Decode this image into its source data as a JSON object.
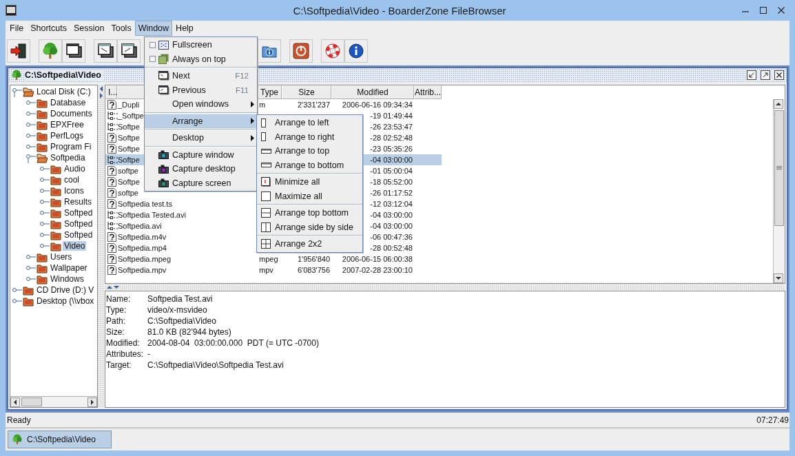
{
  "window": {
    "title": "C:\\Softpedia\\Video - BoarderZone FileBrowser"
  },
  "menu_bar": [
    {
      "label": "File",
      "selected": false
    },
    {
      "label": "Shortcuts",
      "selected": false
    },
    {
      "label": "Session",
      "selected": false
    },
    {
      "label": "Tools",
      "selected": false
    },
    {
      "label": "Window",
      "selected": true
    },
    {
      "label": "Help",
      "selected": false
    }
  ],
  "window_menu": [
    {
      "kind": "check",
      "label": "Fullscreen",
      "checked": false,
      "selected": false
    },
    {
      "kind": "check",
      "label": "Always on top",
      "checked": false,
      "selected": false
    },
    {
      "kind": "separator"
    },
    {
      "kind": "item",
      "label": "Next",
      "shortcut": "F12",
      "selected": false
    },
    {
      "kind": "item",
      "label": "Previous",
      "shortcut": "F11",
      "selected": false
    },
    {
      "kind": "submenu",
      "label": "Open windows",
      "selected": false
    },
    {
      "kind": "separator"
    },
    {
      "kind": "submenu",
      "label": "Arrange",
      "selected": true
    },
    {
      "kind": "separator"
    },
    {
      "kind": "submenu",
      "label": "Desktop",
      "selected": false
    },
    {
      "kind": "separator"
    },
    {
      "kind": "item",
      "label": "Capture window",
      "selected": false
    },
    {
      "kind": "item",
      "label": "Capture desktop",
      "selected": false
    },
    {
      "kind": "item",
      "label": "Capture screen",
      "selected": false
    }
  ],
  "arrange_menu": [
    {
      "kind": "item",
      "label": "Arrange to left",
      "selected": false
    },
    {
      "kind": "item",
      "label": "Arrange to right",
      "selected": false
    },
    {
      "kind": "item",
      "label": "Arrange to top",
      "selected": false
    },
    {
      "kind": "item",
      "label": "Arrange to bottom",
      "selected": false
    },
    {
      "kind": "separator"
    },
    {
      "kind": "item",
      "label": "Minimize all",
      "selected": false
    },
    {
      "kind": "item",
      "label": "Maximize all",
      "selected": false
    },
    {
      "kind": "separator"
    },
    {
      "kind": "item",
      "label": "Arrange top bottom",
      "selected": false
    },
    {
      "kind": "item",
      "label": "Arrange side by side",
      "selected": false
    },
    {
      "kind": "separator"
    },
    {
      "kind": "item",
      "label": "Arrange 2x2",
      "selected": false
    }
  ],
  "frame": {
    "title": "C:\\Softpedia\\Video"
  },
  "tree": [
    {
      "label": "Local Disk (C:)",
      "expanded": true,
      "selected": false,
      "children": [
        {
          "label": "Database",
          "expanded": false,
          "selected": false
        },
        {
          "label": "Documents",
          "expanded": false,
          "selected": false
        },
        {
          "label": "EPXFree",
          "expanded": false,
          "selected": false
        },
        {
          "label": "PerfLogs",
          "expanded": false,
          "selected": false
        },
        {
          "label": "Program Fi",
          "expanded": false,
          "selected": false
        },
        {
          "label": "Softpedia",
          "expanded": true,
          "selected": false,
          "children": [
            {
              "label": "Audio",
              "expanded": false,
              "selected": false
            },
            {
              "label": "cool",
              "expanded": false,
              "selected": false
            },
            {
              "label": "Icons",
              "expanded": false,
              "selected": false
            },
            {
              "label": "Results",
              "expanded": false,
              "selected": false
            },
            {
              "label": "Softped",
              "expanded": false,
              "selected": false
            },
            {
              "label": "Softped",
              "expanded": false,
              "selected": false
            },
            {
              "label": "Softped",
              "expanded": false,
              "selected": false
            },
            {
              "label": "Video",
              "expanded": false,
              "selected": true
            }
          ]
        },
        {
          "label": "Users",
          "expanded": false,
          "selected": false
        },
        {
          "label": "Wallpaper",
          "expanded": false,
          "selected": false
        },
        {
          "label": "Windows",
          "expanded": false,
          "selected": false
        }
      ]
    },
    {
      "label": "CD Drive (D:) V",
      "expanded": false,
      "selected": false
    },
    {
      "label": "Desktop (\\\\vbox",
      "expanded": false,
      "selected": false
    }
  ],
  "table": {
    "columns": [
      "I...",
      "Type",
      "Size",
      "Modified",
      "Attrib..."
    ],
    "rows": [
      {
        "kind": "unknown",
        "name": "_Dupli",
        "type": "m",
        "size": "2'331'237",
        "modified": "2006-06-16 09:34:34",
        "selected": false
      },
      {
        "kind": "linked",
        "name": "_Softpe",
        "modified": "-19 01:49:44",
        "selected": false
      },
      {
        "kind": "linked",
        "name": "Softpe",
        "modified": "-26 23:53:47",
        "selected": false
      },
      {
        "kind": "unknown",
        "name": "Softpe",
        "modified": "-28 02:52:48",
        "selected": false
      },
      {
        "kind": "unknown",
        "name": "Softpe",
        "modified": "-23 05:35:26",
        "selected": false
      },
      {
        "kind": "linked",
        "name": "Softpe",
        "modified": "-04 03:00:00",
        "selected": true
      },
      {
        "kind": "unknown",
        "name": "softpe",
        "modified": "-01 05:00:04",
        "selected": false
      },
      {
        "kind": "unknown",
        "name": "Softpe",
        "modified": "-18 05:52:00",
        "selected": false
      },
      {
        "kind": "unknown",
        "name": "softpe",
        "modified": "-26 01:17:52",
        "selected": false
      },
      {
        "kind": "unknown",
        "name": "Softpedia test.ts",
        "modified": "-12 03:12:04",
        "selected": false
      },
      {
        "kind": "linked",
        "name": "Softpedia Tested.avi",
        "modified": "-04 03:00:00",
        "selected": false
      },
      {
        "kind": "linked",
        "name": "Softpedia.avi",
        "modified": "-04 03:00:00",
        "selected": false
      },
      {
        "kind": "unknown",
        "name": "Softpedia.m4v",
        "modified": "-06 00:47:36",
        "selected": false
      },
      {
        "kind": "unknown",
        "name": "Softpedia.mp4",
        "modified": "-28 00:52:48",
        "selected": false
      },
      {
        "kind": "unknown",
        "name": "Softpedia.mpeg",
        "type": "mpeg",
        "size": "1'956'840",
        "modified": "2006-06-15 06:00:38",
        "selected": false
      },
      {
        "kind": "unknown",
        "name": "Softpedia.mpv",
        "type": "mpv",
        "size": "6'083'756",
        "modified": "2007-02-28 23:00:10",
        "selected": false
      }
    ]
  },
  "details": [
    {
      "label": "Name:",
      "value": "Softpedia Test.avi"
    },
    {
      "label": "Type:",
      "value": "video/x-msvideo"
    },
    {
      "label": "Path:",
      "value": "C:\\Softpedia\\Video"
    },
    {
      "label": "Size:",
      "value": "81.0 KB (82'944 bytes)"
    },
    {
      "label": "Modified:",
      "value": "2004-08-04  03:00:00.000  PDT (= UTC -0700)"
    },
    {
      "label": "Attributes:",
      "value": "-"
    },
    {
      "label": "Target:",
      "value": "C:\\Softpedia\\Video\\Softpedia Test.avi"
    }
  ],
  "status_bar": {
    "message": "Ready",
    "time": "07:27:49"
  },
  "taskbar": [
    {
      "label": "C:\\Softpedia\\Video",
      "selected": true
    }
  ]
}
